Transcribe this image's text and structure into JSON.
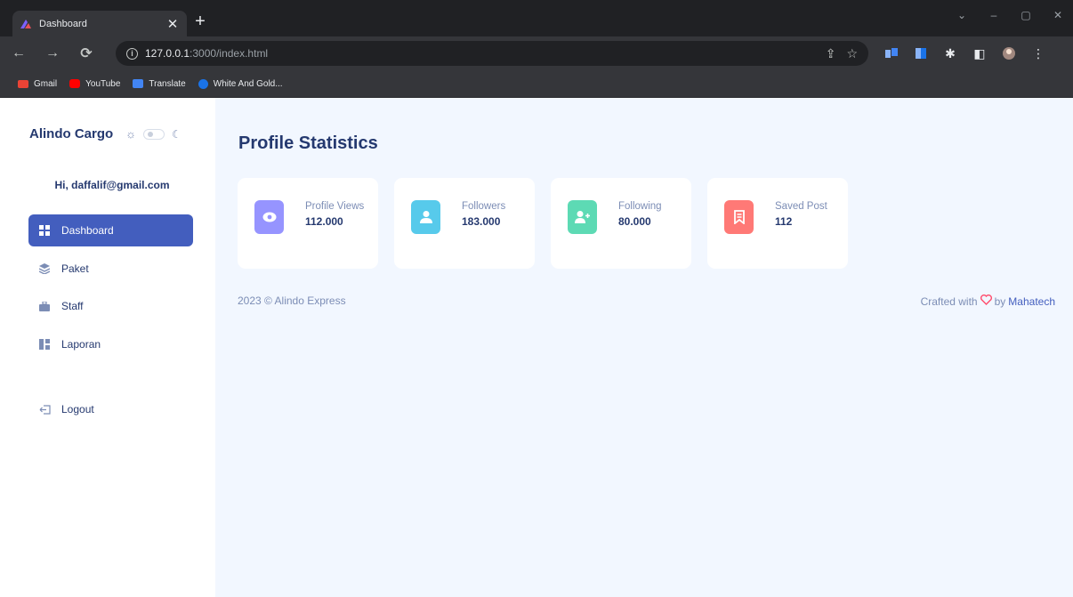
{
  "browser": {
    "tab_title": "Dashboard",
    "url_host": "127.0.0.1",
    "url_path": ":3000/index.html",
    "bookmarks": [
      {
        "label": "Gmail",
        "color": "#ea4335"
      },
      {
        "label": "YouTube",
        "color": "#ff0000"
      },
      {
        "label": "Translate",
        "color": "#4285f4"
      },
      {
        "label": "White And Gold...",
        "color": "#1a73e8"
      }
    ]
  },
  "sidebar": {
    "brand": "Alindo Cargo",
    "greeting": "Hi, daffalif@gmail.com",
    "items": [
      {
        "label": "Dashboard",
        "icon": "grid-icon",
        "active": true
      },
      {
        "label": "Paket",
        "icon": "stack-icon",
        "active": false
      },
      {
        "label": "Staff",
        "icon": "briefcase-icon",
        "active": false
      },
      {
        "label": "Laporan",
        "icon": "layout-icon",
        "active": false
      }
    ],
    "logout_label": "Logout"
  },
  "main": {
    "title": "Profile Statistics",
    "cards": [
      {
        "label": "Profile Views",
        "value": "112.000",
        "icon": "eye-icon",
        "color": "#9694ff"
      },
      {
        "label": "Followers",
        "value": "183.000",
        "icon": "user-icon",
        "color": "#57caeb"
      },
      {
        "label": "Following",
        "value": "80.000",
        "icon": "user-plus-icon",
        "color": "#5ddab4"
      },
      {
        "label": "Saved Post",
        "value": "112",
        "icon": "bookmark-icon",
        "color": "#ff7976"
      }
    ],
    "footer_left": "2023 © Alindo Express",
    "footer_crafted": "Crafted with",
    "footer_by": "by",
    "footer_brand": "Mahatech"
  },
  "colors": {
    "primary": "#435ebe",
    "text_dark": "#25396f",
    "text_muted": "#7c8db5",
    "background": "#f2f7ff"
  }
}
